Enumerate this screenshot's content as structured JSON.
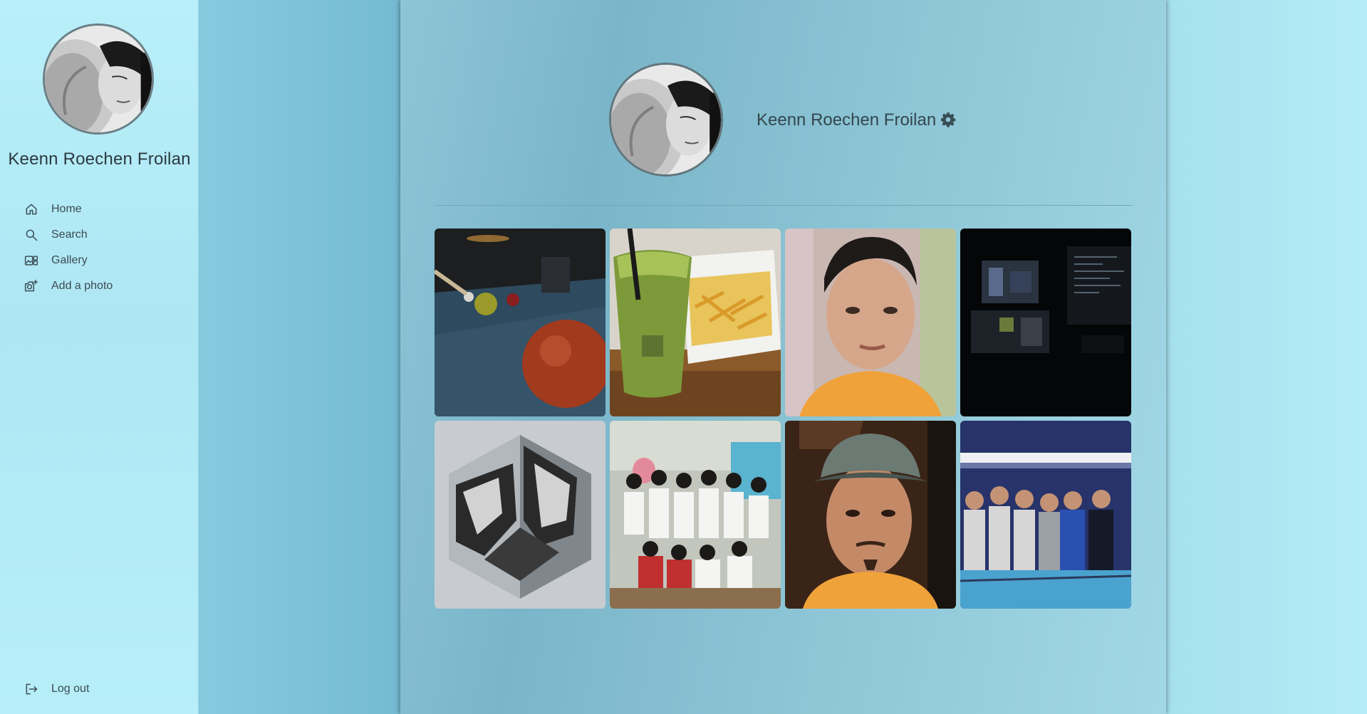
{
  "user": {
    "name": "Keenn Roechen Froilan",
    "avatar_icon": "profile-photo"
  },
  "sidebar": {
    "items": [
      {
        "label": "Home",
        "icon": "home-icon"
      },
      {
        "label": "Search",
        "icon": "search-icon"
      },
      {
        "label": "Gallery",
        "icon": "gallery-icon"
      },
      {
        "label": "Add a photo",
        "icon": "add-photo-icon"
      }
    ],
    "logout_label": "Log out",
    "logout_icon": "logout-icon"
  },
  "profile": {
    "name": "Keenn Roechen Froilan",
    "settings_icon": "gear-icon"
  },
  "gallery": {
    "photos": [
      {
        "subject": "billiard-balls"
      },
      {
        "subject": "matcha-drink-and-fries"
      },
      {
        "subject": "selfie-orange-shirt"
      },
      {
        "subject": "dark-desk-monitors"
      },
      {
        "subject": "wolf-hexagon-logo"
      },
      {
        "subject": "group-photo-classroom"
      },
      {
        "subject": "selfie-cap"
      },
      {
        "subject": "group-photo-billiards"
      }
    ]
  },
  "colors": {
    "sidebar_bg": "#b8eff8",
    "panel_bg": "#8dc5d6",
    "text": "#2c3a40"
  }
}
